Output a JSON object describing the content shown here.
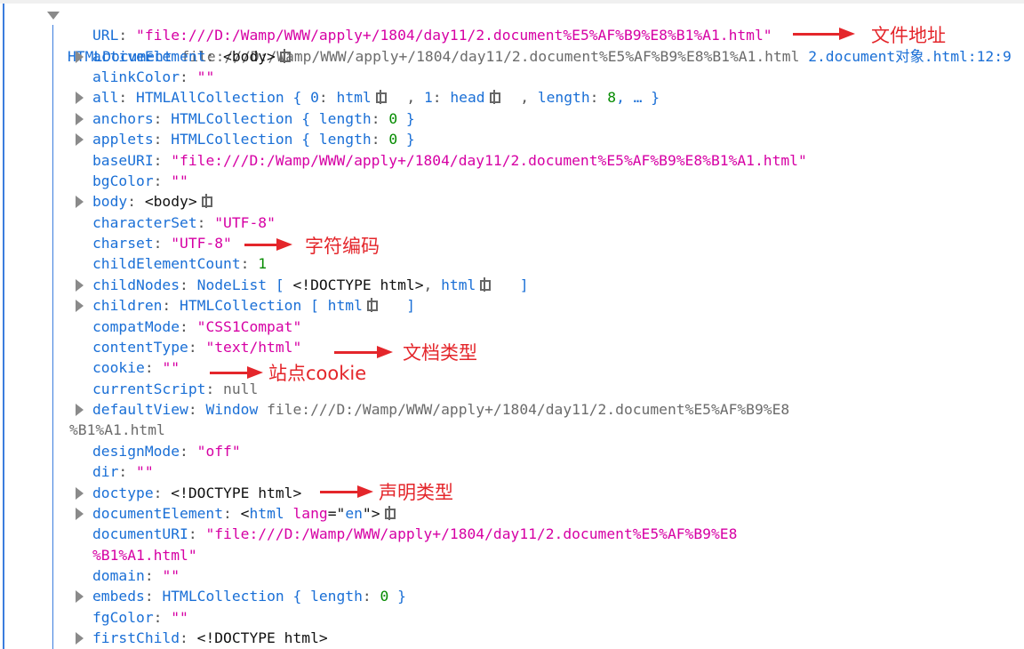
{
  "header": {
    "segments": [
      {
        "t": "HTMLDocument ",
        "c": "k"
      },
      {
        "t": "file:///D:/Wamp/WWW/apply+/1804/day11/2.document%E5%AF%B9%E8%B1%A1.html ",
        "c": "g"
      },
      {
        "t": "2.document对象.html:12:9",
        "c": "k"
      }
    ]
  },
  "rows": [
    {
      "exp": false,
      "indent": 104,
      "seg": [
        {
          "t": "URL",
          "c": "k"
        },
        {
          "t": ": ",
          "c": "p"
        },
        {
          "t": "\"file:///D:/Wamp/WWW/apply+/1804/day11/2.document%E5%AF%B9%E8%B1%A1.html\"",
          "c": "s"
        }
      ]
    },
    {
      "exp": true,
      "indent": 104,
      "seg": [
        {
          "t": "activeElement",
          "c": "k"
        },
        {
          "t": ": ",
          "c": "p"
        },
        {
          "t": "<body>",
          "c": "b"
        },
        {
          "node": true
        }
      ]
    },
    {
      "exp": false,
      "indent": 104,
      "seg": [
        {
          "t": "alinkColor",
          "c": "k"
        },
        {
          "t": ": ",
          "c": "p"
        },
        {
          "t": "\"\"",
          "c": "s"
        }
      ]
    },
    {
      "exp": true,
      "indent": 104,
      "seg": [
        {
          "t": "all",
          "c": "k"
        },
        {
          "t": ": ",
          "c": "p"
        },
        {
          "t": "HTMLAllCollection",
          "c": "o"
        },
        {
          "t": " { ",
          "c": "o"
        },
        {
          "t": "0",
          "c": "k"
        },
        {
          "t": ": ",
          "c": "p"
        },
        {
          "t": "html",
          "c": "o"
        },
        {
          "node": true
        },
        {
          "t": "  , ",
          "c": "p"
        },
        {
          "t": "1",
          "c": "k"
        },
        {
          "t": ": ",
          "c": "p"
        },
        {
          "t": "head",
          "c": "o"
        },
        {
          "node": true
        },
        {
          "t": "  , ",
          "c": "p"
        },
        {
          "t": "length",
          "c": "k"
        },
        {
          "t": ": ",
          "c": "p"
        },
        {
          "t": "8",
          "c": "n"
        },
        {
          "t": ", … }",
          "c": "o"
        }
      ]
    },
    {
      "exp": true,
      "indent": 104,
      "seg": [
        {
          "t": "anchors",
          "c": "k"
        },
        {
          "t": ": ",
          "c": "p"
        },
        {
          "t": "HTMLCollection { ",
          "c": "o"
        },
        {
          "t": "length",
          "c": "k"
        },
        {
          "t": ": ",
          "c": "p"
        },
        {
          "t": "0",
          "c": "n"
        },
        {
          "t": " }",
          "c": "o"
        }
      ]
    },
    {
      "exp": true,
      "indent": 104,
      "seg": [
        {
          "t": "applets",
          "c": "k"
        },
        {
          "t": ": ",
          "c": "p"
        },
        {
          "t": "HTMLCollection { ",
          "c": "o"
        },
        {
          "t": "length",
          "c": "k"
        },
        {
          "t": ": ",
          "c": "p"
        },
        {
          "t": "0",
          "c": "n"
        },
        {
          "t": " }",
          "c": "o"
        }
      ]
    },
    {
      "exp": false,
      "indent": 104,
      "seg": [
        {
          "t": "baseURI",
          "c": "k"
        },
        {
          "t": ": ",
          "c": "p"
        },
        {
          "t": "\"file:///D:/Wamp/WWW/apply+/1804/day11/2.document%E5%AF%B9%E8%B1%A1.html\"",
          "c": "s"
        }
      ]
    },
    {
      "exp": false,
      "indent": 104,
      "seg": [
        {
          "t": "bgColor",
          "c": "k"
        },
        {
          "t": ": ",
          "c": "p"
        },
        {
          "t": "\"\"",
          "c": "s"
        }
      ]
    },
    {
      "exp": true,
      "indent": 104,
      "seg": [
        {
          "t": "body",
          "c": "k"
        },
        {
          "t": ": ",
          "c": "p"
        },
        {
          "t": "<body>",
          "c": "b"
        },
        {
          "node": true
        }
      ]
    },
    {
      "exp": false,
      "indent": 104,
      "seg": [
        {
          "t": "characterSet",
          "c": "k"
        },
        {
          "t": ": ",
          "c": "p"
        },
        {
          "t": "\"UTF-8\"",
          "c": "s"
        }
      ]
    },
    {
      "exp": false,
      "indent": 104,
      "seg": [
        {
          "t": "charset",
          "c": "k"
        },
        {
          "t": ": ",
          "c": "p"
        },
        {
          "t": "\"UTF-8\"",
          "c": "s"
        }
      ]
    },
    {
      "exp": false,
      "indent": 104,
      "seg": [
        {
          "t": "childElementCount",
          "c": "k"
        },
        {
          "t": ": ",
          "c": "p"
        },
        {
          "t": "1",
          "c": "n"
        }
      ]
    },
    {
      "exp": true,
      "indent": 104,
      "seg": [
        {
          "t": "childNodes",
          "c": "k"
        },
        {
          "t": ": ",
          "c": "p"
        },
        {
          "t": "NodeList [ ",
          "c": "o"
        },
        {
          "t": "<!DOCTYPE html>",
          "c": "b"
        },
        {
          "t": ", ",
          "c": "p"
        },
        {
          "t": "html",
          "c": "o"
        },
        {
          "node": true
        },
        {
          "t": "   ]",
          "c": "o"
        }
      ]
    },
    {
      "exp": true,
      "indent": 104,
      "seg": [
        {
          "t": "children",
          "c": "k"
        },
        {
          "t": ": ",
          "c": "p"
        },
        {
          "t": "HTMLCollection [ ",
          "c": "o"
        },
        {
          "t": "html",
          "c": "o"
        },
        {
          "node": true
        },
        {
          "t": "   ]",
          "c": "o"
        }
      ]
    },
    {
      "exp": false,
      "indent": 104,
      "seg": [
        {
          "t": "compatMode",
          "c": "k"
        },
        {
          "t": ": ",
          "c": "p"
        },
        {
          "t": "\"CSS1Compat\"",
          "c": "s"
        }
      ]
    },
    {
      "exp": false,
      "indent": 104,
      "seg": [
        {
          "t": "contentType",
          "c": "k"
        },
        {
          "t": ": ",
          "c": "p"
        },
        {
          "t": "\"text/html\"",
          "c": "s"
        }
      ]
    },
    {
      "exp": false,
      "indent": 104,
      "seg": [
        {
          "t": "cookie",
          "c": "k"
        },
        {
          "t": ": ",
          "c": "p"
        },
        {
          "t": "\"\"",
          "c": "s"
        }
      ]
    },
    {
      "exp": false,
      "indent": 104,
      "seg": [
        {
          "t": "currentScript",
          "c": "k"
        },
        {
          "t": ": ",
          "c": "p"
        },
        {
          "t": "null",
          "c": "g"
        }
      ]
    },
    {
      "exp": true,
      "indent": 104,
      "seg": [
        {
          "t": "defaultView",
          "c": "k"
        },
        {
          "t": ": ",
          "c": "p"
        },
        {
          "t": "Window ",
          "c": "o"
        },
        {
          "t": "file:///D:/Wamp/WWW/apply+/1804/day11/2.document%E5%AF%B9%E8",
          "c": "g"
        }
      ]
    },
    {
      "exp": false,
      "indent": 78,
      "seg": [
        {
          "t": "%B1%A1.html",
          "c": "g"
        }
      ]
    },
    {
      "exp": false,
      "indent": 104,
      "seg": [
        {
          "t": "designMode",
          "c": "k"
        },
        {
          "t": ": ",
          "c": "p"
        },
        {
          "t": "\"off\"",
          "c": "s"
        }
      ]
    },
    {
      "exp": false,
      "indent": 104,
      "seg": [
        {
          "t": "dir",
          "c": "k"
        },
        {
          "t": ": ",
          "c": "p"
        },
        {
          "t": "\"\"",
          "c": "s"
        }
      ]
    },
    {
      "exp": true,
      "indent": 104,
      "seg": [
        {
          "t": "doctype",
          "c": "k"
        },
        {
          "t": ": ",
          "c": "p"
        },
        {
          "t": "<!DOCTYPE html>",
          "c": "b"
        }
      ]
    },
    {
      "exp": true,
      "indent": 104,
      "seg": [
        {
          "t": "documentElement",
          "c": "k"
        },
        {
          "t": ": ",
          "c": "p"
        },
        {
          "t": "<",
          "c": "b"
        },
        {
          "t": "html ",
          "c": "o"
        },
        {
          "t": "lang",
          "c": "s"
        },
        {
          "t": "=\"",
          "c": "b"
        },
        {
          "t": "en",
          "c": "o"
        },
        {
          "t": "\">",
          "c": "b"
        },
        {
          "node": true
        }
      ]
    },
    {
      "exp": false,
      "indent": 104,
      "seg": [
        {
          "t": "documentURI",
          "c": "k"
        },
        {
          "t": ": ",
          "c": "p"
        },
        {
          "t": "\"file:///D:/Wamp/WWW/apply+/1804/day11/2.document%E5%AF%B9%E8",
          "c": "s"
        }
      ]
    },
    {
      "exp": false,
      "indent": 104,
      "seg": [
        {
          "t": "%B1%A1.html\"",
          "c": "s"
        }
      ]
    },
    {
      "exp": false,
      "indent": 104,
      "seg": [
        {
          "t": "domain",
          "c": "k"
        },
        {
          "t": ": ",
          "c": "p"
        },
        {
          "t": "\"\"",
          "c": "s"
        }
      ]
    },
    {
      "exp": true,
      "indent": 104,
      "seg": [
        {
          "t": "embeds",
          "c": "k"
        },
        {
          "t": ": ",
          "c": "p"
        },
        {
          "t": "HTMLCollection { ",
          "c": "o"
        },
        {
          "t": "length",
          "c": "k"
        },
        {
          "t": ": ",
          "c": "p"
        },
        {
          "t": "0",
          "c": "n"
        },
        {
          "t": " }",
          "c": "o"
        }
      ]
    },
    {
      "exp": false,
      "indent": 104,
      "seg": [
        {
          "t": "fgColor",
          "c": "k"
        },
        {
          "t": ": ",
          "c": "p"
        },
        {
          "t": "\"\"",
          "c": "s"
        }
      ]
    },
    {
      "exp": true,
      "indent": 104,
      "seg": [
        {
          "t": "firstChild",
          "c": "k"
        },
        {
          "t": ": ",
          "c": "p"
        },
        {
          "t": "<!DOCTYPE html>",
          "c": "b"
        }
      ]
    }
  ],
  "annotations": {
    "url": "文件地址",
    "charset": "字符编码",
    "contentType": "文档类型",
    "cookie": "站点cookie",
    "doctype": "声明类型"
  },
  "colors": {
    "annotation": "#e4262b",
    "key": "#1a6fd6",
    "string": "#d600a4",
    "number": "#058b00"
  }
}
